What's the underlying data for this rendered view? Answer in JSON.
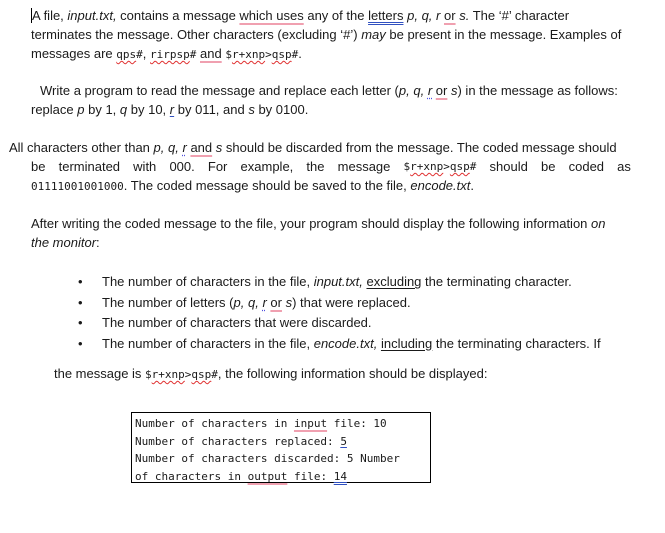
{
  "para1": {
    "line1": {
      "t1": "A file, ",
      "file": "input.txt,",
      "t2": " contains a message ",
      "which_uses": "which uses",
      "t3": " any of the ",
      "letters": "letters",
      "t4": " ",
      "p": "p,",
      "q": "q,",
      "r": "r",
      "or": "or",
      "s": "s.",
      "t5": " The ‘#’ character"
    },
    "line2": {
      "t1": "terminates the message. Other characters (excluding ‘#’) ",
      "may": "may",
      "t2": " be present in the message. Examples of"
    },
    "line3": {
      "t1": "messages are ",
      "ex1": "qps",
      "ex1_end": "#",
      "sep1": ", ",
      "ex2": "rirpsp",
      "ex2_end": "#",
      "sep2": " ",
      "and": "and",
      "sep3": " ",
      "ex3_start": "$",
      "ex3a": "r+xnp",
      "ex3b": ">",
      "ex3c": "qsp",
      "ex3_end": "#",
      "end": "."
    }
  },
  "para2": {
    "line1": {
      "t1": "Write a program to read the message and replace each letter (",
      "p": "p,",
      "q": "q,",
      "r": "r",
      "or": "or",
      "s": "s",
      "t2": ") in the message as follows:"
    },
    "line2": {
      "t1": "replace ",
      "p": "p",
      "t2": " by 1, ",
      "q": "q",
      "t3": " by 10, ",
      "r": "r",
      "t4": " by 011, and ",
      "s": "s",
      "t5": " by 0100."
    }
  },
  "para3": {
    "line1": {
      "t1": "All characters other than ",
      "p": "p,",
      "q": "q,",
      "r": "r",
      "and": "and",
      "s": "s",
      "t2": " should be discarded from the message. The coded message should"
    },
    "line2": {
      "words": [
        "be",
        "terminated",
        "with",
        "000.",
        "For",
        "example,",
        "the",
        "message"
      ],
      "msg_start": "$",
      "msg_a": "r+xnp",
      "msg_b": ">",
      "msg_c": "qsp",
      "msg_end": "#",
      "words2": [
        "should",
        "be",
        "coded",
        "as"
      ]
    },
    "line3": {
      "code": "01111001001000",
      "t1": ". The coded message should be saved to the file, ",
      "file": "encode.txt",
      "end": "."
    }
  },
  "para4": {
    "line1": {
      "t1": "After writing the coded message to the file, your program should display the following information ",
      "on": "on"
    },
    "line2": {
      "monitor": "the monitor",
      "end": ":"
    }
  },
  "bullets": {
    "symbol": "•",
    "b1": {
      "t1": "The number of characters in the file, ",
      "file": "input.txt,",
      "t2": " ",
      "excluding": "excluding",
      "t3": " the terminating character."
    },
    "b2": {
      "t1": "The number of letters (",
      "p": "p,",
      "q": "q,",
      "r": "r",
      "or": "or",
      "s": "s",
      "t2": ") that were replaced."
    },
    "b3": {
      "t1": "The number of characters that were discarded."
    },
    "b4": {
      "t1": "The number of characters in the file, ",
      "file": "encode.txt,",
      "t2": " ",
      "including": "including",
      "t3": " the terminating characters. If"
    }
  },
  "para5": {
    "t1": "the message is ",
    "msg_start": "$",
    "msg_a": "r+xnp",
    "msg_b": ">",
    "msg_c": "qsp",
    "msg_end": "#",
    "t2": ", the following information should be displayed:"
  },
  "output_box": {
    "line1": {
      "t1": "Number of characters in ",
      "input": "input",
      "t2": " file: 10"
    },
    "line2": {
      "t1": "Number of characters replaced: ",
      "val": "5"
    },
    "line3": {
      "t1": "Number of characters discarded: 5 Number"
    },
    "line4": {
      "t1": "of characters in ",
      "output": "output",
      "t2": " file: ",
      "val": "14"
    }
  }
}
